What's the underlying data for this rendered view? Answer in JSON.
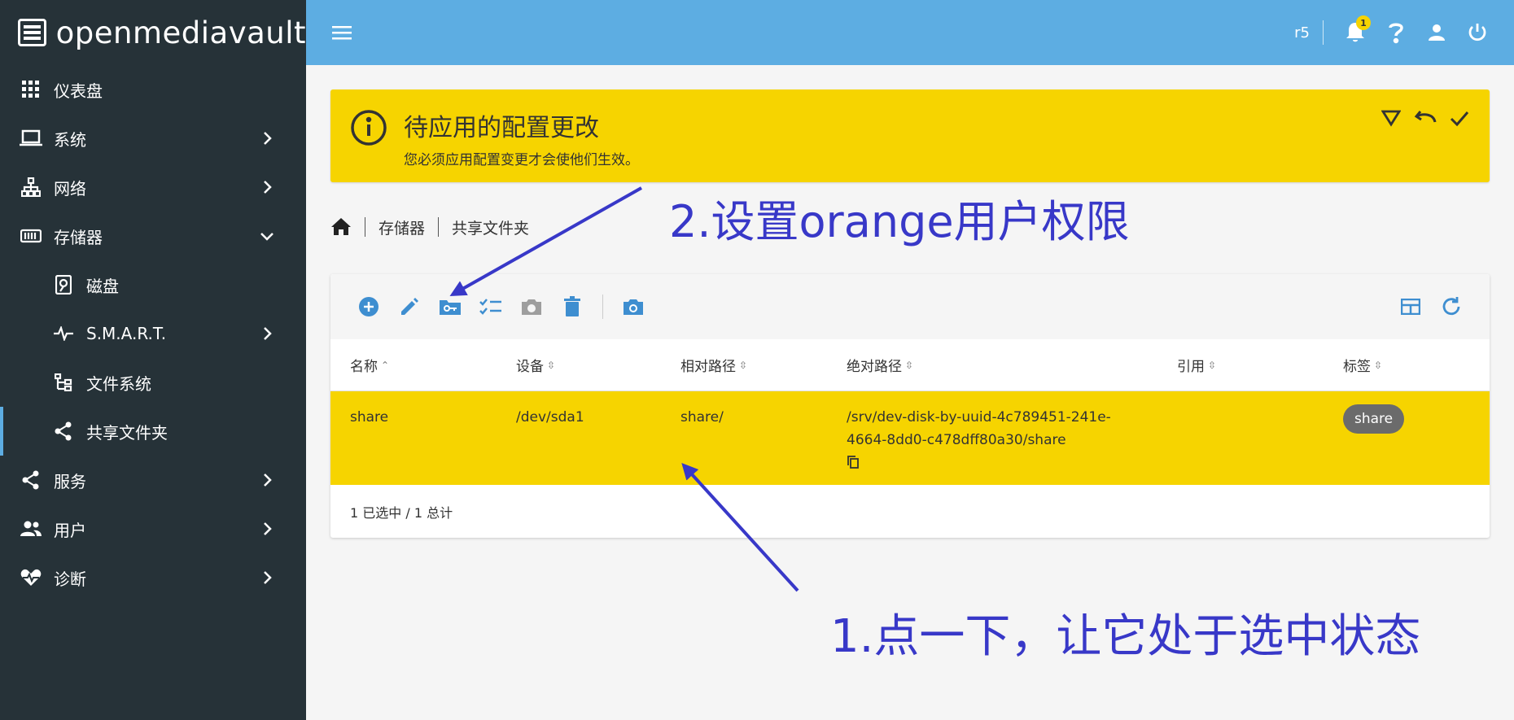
{
  "brand": {
    "name": "openmediavault"
  },
  "sidebar": {
    "items": [
      {
        "label": "仪表盘",
        "icon": "grid-icon",
        "has_chevron": false
      },
      {
        "label": "系统",
        "icon": "laptop-icon",
        "has_chevron": true
      },
      {
        "label": "网络",
        "icon": "network-icon",
        "has_chevron": true
      },
      {
        "label": "存储器",
        "icon": "storage-icon",
        "has_chevron": true,
        "expanded": true
      },
      {
        "label": "磁盘",
        "icon": "disk-icon",
        "sub": true
      },
      {
        "label": "S.M.A.R.T.",
        "icon": "pulse-icon",
        "sub": true,
        "has_chevron": true
      },
      {
        "label": "文件系统",
        "icon": "tree-icon",
        "sub": true
      },
      {
        "label": "共享文件夹",
        "icon": "share-icon",
        "sub": true,
        "active": true
      },
      {
        "label": "服务",
        "icon": "share-icon",
        "has_chevron": true
      },
      {
        "label": "用户",
        "icon": "users-icon",
        "has_chevron": true
      },
      {
        "label": "诊断",
        "icon": "heart-pulse-icon",
        "has_chevron": true
      }
    ]
  },
  "header": {
    "hostname": "r5",
    "notification_count": "1",
    "accent": "#5dade2"
  },
  "banner": {
    "title": "待应用的配置更改",
    "message": "您必须应用配置变更才会使他们生效。",
    "color": "#f6d400"
  },
  "breadcrumb": {
    "items": [
      "存储器",
      "共享文件夹"
    ]
  },
  "table": {
    "columns": [
      {
        "label": "名称",
        "sort": "asc"
      },
      {
        "label": "设备",
        "sort": "none"
      },
      {
        "label": "相对路径",
        "sort": "none"
      },
      {
        "label": "绝对路径",
        "sort": "none"
      },
      {
        "label": "引用",
        "sort": "none"
      },
      {
        "label": "标签",
        "sort": "none"
      }
    ],
    "rows": [
      {
        "name": "share",
        "device": "/dev/sda1",
        "relpath": "share/",
        "abspath_line1": "/srv/dev-disk-by-uuid-4c789451-241e-",
        "abspath_line2": "4664-8dd0-c478dff80a30/share",
        "tag": "share"
      }
    ],
    "footer": "1 已选中 / 1 总计"
  },
  "annotations": {
    "step2": "2.设置orange用户权限",
    "step1": "1.点一下，让它处于选中状态",
    "color": "#3838c8"
  }
}
